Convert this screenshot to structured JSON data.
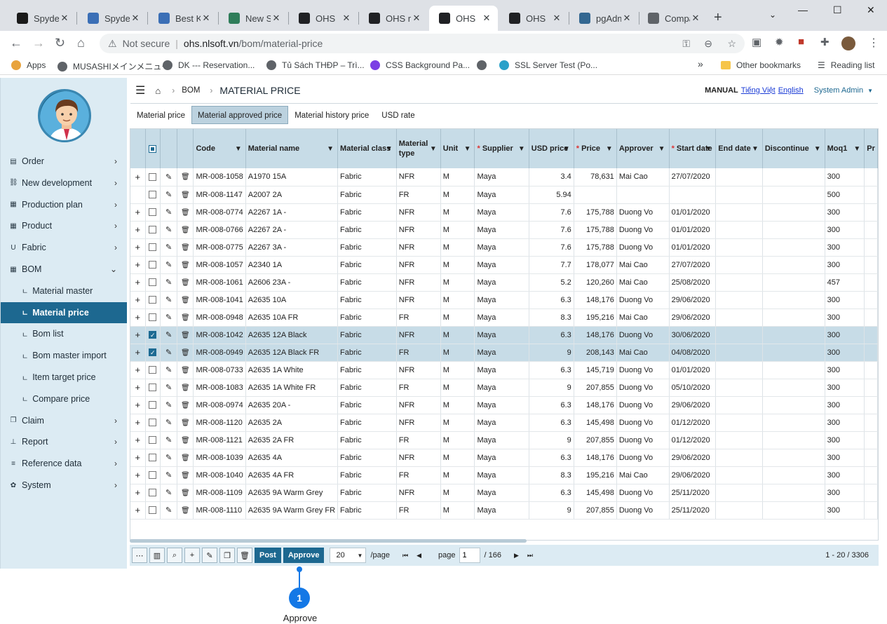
{
  "browser": {
    "tabs": [
      {
        "title": "Spyder",
        "color": "#1a1a1a"
      },
      {
        "title": "Spyder",
        "color": "#3b6fb6"
      },
      {
        "title": "Best K",
        "color": "#3b6fb6"
      },
      {
        "title": "New Sp",
        "color": "#2f7d5a"
      },
      {
        "title": "OHS",
        "color": "#202124"
      },
      {
        "title": "OHS m",
        "color": "#202124"
      },
      {
        "title": "OHS",
        "color": "#202124"
      },
      {
        "title": "OHS",
        "color": "#202124"
      },
      {
        "title": "pgAdm",
        "color": "#336791"
      },
      {
        "title": "Compa",
        "color": "#5f6368"
      }
    ],
    "active_tab": 6,
    "new_tab": "+",
    "url_security": "Not secure",
    "url_host": "ohs.nlsoft.vn",
    "url_path": "/bom/material-price",
    "bookmarks": [
      "Apps",
      "MUSASHIメインメニュー",
      "DK --- Reservation...",
      "Tủ Sách THĐP – Trì...",
      "CSS Background Pa...",
      "",
      "SSL Server Test (Po..."
    ],
    "other_bookmarks": "Other bookmarks",
    "reading_list": "Reading list",
    "more_bookmarks": "»"
  },
  "sidebar": {
    "items": [
      {
        "label": "Order",
        "icon": "document-icon",
        "type": "main"
      },
      {
        "label": "New development",
        "icon": "link-icon",
        "type": "main"
      },
      {
        "label": "Production plan",
        "icon": "grid-icon",
        "type": "main"
      },
      {
        "label": "Product",
        "icon": "grid-icon",
        "type": "main"
      },
      {
        "label": "Fabric",
        "icon": "magnet-icon",
        "type": "main"
      },
      {
        "label": "BOM",
        "icon": "grid-icon",
        "type": "open"
      },
      {
        "label": "Material master",
        "type": "sub"
      },
      {
        "label": "Material price",
        "type": "sub",
        "active": true
      },
      {
        "label": "Bom list",
        "type": "sub"
      },
      {
        "label": "Bom master import",
        "type": "sub"
      },
      {
        "label": "Item target price",
        "type": "sub"
      },
      {
        "label": "Compare price",
        "type": "sub"
      },
      {
        "label": "Claim",
        "icon": "copy-icon",
        "type": "main"
      },
      {
        "label": "Report",
        "icon": "sitemap-icon",
        "type": "main"
      },
      {
        "label": "Reference data",
        "icon": "database-icon",
        "type": "main"
      },
      {
        "label": "System",
        "icon": "gear-icon",
        "type": "main"
      }
    ]
  },
  "header": {
    "breadcrumb_bom": "BOM",
    "page_title": "MATERIAL PRICE",
    "manual": "MANUAL",
    "lang_vi": "Tiếng Việt",
    "lang_en": "English",
    "user": "System Admin"
  },
  "subtabs": [
    "Material price",
    "Material approved price",
    "Material history price",
    "USD rate"
  ],
  "active_subtab": 1,
  "grid": {
    "columns": [
      {
        "label": "Code",
        "filter": true
      },
      {
        "label": "Material name",
        "filter": true
      },
      {
        "label": "Material class",
        "filter": true
      },
      {
        "label": "Material type",
        "filter": true
      },
      {
        "label": "Unit",
        "filter": true
      },
      {
        "label": "Supplier",
        "filter": true,
        "required": true
      },
      {
        "label": "USD price",
        "filter": true
      },
      {
        "label": "Price",
        "filter": true,
        "required": true
      },
      {
        "label": "Approver",
        "filter": true
      },
      {
        "label": "Start date",
        "filter": true,
        "required": true
      },
      {
        "label": "End date",
        "filter": true
      },
      {
        "label": "Discontinue",
        "filter": true
      },
      {
        "label": "Moq1",
        "filter": true
      },
      {
        "label": "Pr",
        "filter": false
      }
    ],
    "rows": [
      {
        "code": "MR-008-1058",
        "name": "A1970 15A",
        "cls": "Fabric",
        "type": "NFR",
        "unit": "M",
        "supplier": "Maya",
        "usd": "3.4",
        "price": "78,631",
        "approver": "Mai Cao",
        "start": "27/07/2020",
        "end": "",
        "disc": "",
        "moq1": "300",
        "checked": false,
        "expand": true
      },
      {
        "code": "MR-008-1147",
        "name": "A2007 2A",
        "cls": "Fabric",
        "type": "FR",
        "unit": "M",
        "supplier": "Maya",
        "usd": "5.94",
        "price": "",
        "approver": "",
        "start": "",
        "end": "",
        "disc": "",
        "moq1": "500",
        "checked": false,
        "expand": false
      },
      {
        "code": "MR-008-0774",
        "name": "A2267 1A -",
        "cls": "Fabric",
        "type": "NFR",
        "unit": "M",
        "supplier": "Maya",
        "usd": "7.6",
        "price": "175,788",
        "approver": "Duong Vo",
        "start": "01/01/2020",
        "end": "",
        "disc": "",
        "moq1": "300",
        "checked": false,
        "expand": true
      },
      {
        "code": "MR-008-0766",
        "name": "A2267 2A -",
        "cls": "Fabric",
        "type": "NFR",
        "unit": "M",
        "supplier": "Maya",
        "usd": "7.6",
        "price": "175,788",
        "approver": "Duong Vo",
        "start": "01/01/2020",
        "end": "",
        "disc": "",
        "moq1": "300",
        "checked": false,
        "expand": true
      },
      {
        "code": "MR-008-0775",
        "name": "A2267 3A -",
        "cls": "Fabric",
        "type": "NFR",
        "unit": "M",
        "supplier": "Maya",
        "usd": "7.6",
        "price": "175,788",
        "approver": "Duong Vo",
        "start": "01/01/2020",
        "end": "",
        "disc": "",
        "moq1": "300",
        "checked": false,
        "expand": true
      },
      {
        "code": "MR-008-1057",
        "name": "A2340 1A",
        "cls": "Fabric",
        "type": "NFR",
        "unit": "M",
        "supplier": "Maya",
        "usd": "7.7",
        "price": "178,077",
        "approver": "Mai Cao",
        "start": "27/07/2020",
        "end": "",
        "disc": "",
        "moq1": "300",
        "checked": false,
        "expand": true
      },
      {
        "code": "MR-008-1061",
        "name": "A2606 23A -",
        "cls": "Fabric",
        "type": "NFR",
        "unit": "M",
        "supplier": "Maya",
        "usd": "5.2",
        "price": "120,260",
        "approver": "Mai Cao",
        "start": "25/08/2020",
        "end": "",
        "disc": "",
        "moq1": "457",
        "checked": false,
        "expand": true
      },
      {
        "code": "MR-008-1041",
        "name": "A2635 10A",
        "cls": "Fabric",
        "type": "NFR",
        "unit": "M",
        "supplier": "Maya",
        "usd": "6.3",
        "price": "148,176",
        "approver": "Duong Vo",
        "start": "29/06/2020",
        "end": "",
        "disc": "",
        "moq1": "300",
        "checked": false,
        "expand": true
      },
      {
        "code": "MR-008-0948",
        "name": "A2635 10A FR",
        "cls": "Fabric",
        "type": "FR",
        "unit": "M",
        "supplier": "Maya",
        "usd": "8.3",
        "price": "195,216",
        "approver": "Mai Cao",
        "start": "29/06/2020",
        "end": "",
        "disc": "",
        "moq1": "300",
        "checked": false,
        "expand": true
      },
      {
        "code": "MR-008-1042",
        "name": "A2635 12A Black",
        "cls": "Fabric",
        "type": "NFR",
        "unit": "M",
        "supplier": "Maya",
        "usd": "6.3",
        "price": "148,176",
        "approver": "Duong Vo",
        "start": "30/06/2020",
        "end": "",
        "disc": "",
        "moq1": "300",
        "checked": true,
        "expand": true
      },
      {
        "code": "MR-008-0949",
        "name": "A2635 12A Black FR",
        "cls": "Fabric",
        "type": "FR",
        "unit": "M",
        "supplier": "Maya",
        "usd": "9",
        "price": "208,143",
        "approver": "Mai Cao",
        "start": "04/08/2020",
        "end": "",
        "disc": "",
        "moq1": "300",
        "checked": true,
        "expand": true
      },
      {
        "code": "MR-008-0733",
        "name": "A2635 1A White",
        "cls": "Fabric",
        "type": "NFR",
        "unit": "M",
        "supplier": "Maya",
        "usd": "6.3",
        "price": "145,719",
        "approver": "Duong Vo",
        "start": "01/01/2020",
        "end": "",
        "disc": "",
        "moq1": "300",
        "checked": false,
        "expand": true
      },
      {
        "code": "MR-008-1083",
        "name": "A2635 1A White FR",
        "cls": "Fabric",
        "type": "FR",
        "unit": "M",
        "supplier": "Maya",
        "usd": "9",
        "price": "207,855",
        "approver": "Duong Vo",
        "start": "05/10/2020",
        "end": "",
        "disc": "",
        "moq1": "300",
        "checked": false,
        "expand": true
      },
      {
        "code": "MR-008-0974",
        "name": "A2635 20A -",
        "cls": "Fabric",
        "type": "NFR",
        "unit": "M",
        "supplier": "Maya",
        "usd": "6.3",
        "price": "148,176",
        "approver": "Duong Vo",
        "start": "29/06/2020",
        "end": "",
        "disc": "",
        "moq1": "300",
        "checked": false,
        "expand": true
      },
      {
        "code": "MR-008-1120",
        "name": "A2635 2A",
        "cls": "Fabric",
        "type": "NFR",
        "unit": "M",
        "supplier": "Maya",
        "usd": "6.3",
        "price": "145,498",
        "approver": "Duong Vo",
        "start": "01/12/2020",
        "end": "",
        "disc": "",
        "moq1": "300",
        "checked": false,
        "expand": true
      },
      {
        "code": "MR-008-1121",
        "name": "A2635 2A FR",
        "cls": "Fabric",
        "type": "FR",
        "unit": "M",
        "supplier": "Maya",
        "usd": "9",
        "price": "207,855",
        "approver": "Duong Vo",
        "start": "01/12/2020",
        "end": "",
        "disc": "",
        "moq1": "300",
        "checked": false,
        "expand": true
      },
      {
        "code": "MR-008-1039",
        "name": "A2635 4A",
        "cls": "Fabric",
        "type": "NFR",
        "unit": "M",
        "supplier": "Maya",
        "usd": "6.3",
        "price": "148,176",
        "approver": "Duong Vo",
        "start": "29/06/2020",
        "end": "",
        "disc": "",
        "moq1": "300",
        "checked": false,
        "expand": true
      },
      {
        "code": "MR-008-1040",
        "name": "A2635 4A FR",
        "cls": "Fabric",
        "type": "FR",
        "unit": "M",
        "supplier": "Maya",
        "usd": "8.3",
        "price": "195,216",
        "approver": "Mai Cao",
        "start": "29/06/2020",
        "end": "",
        "disc": "",
        "moq1": "300",
        "checked": false,
        "expand": true
      },
      {
        "code": "MR-008-1109",
        "name": "A2635 9A Warm Grey",
        "cls": "Fabric",
        "type": "NFR",
        "unit": "M",
        "supplier": "Maya",
        "usd": "6.3",
        "price": "145,498",
        "approver": "Duong Vo",
        "start": "25/11/2020",
        "end": "",
        "disc": "",
        "moq1": "300",
        "checked": false,
        "expand": true
      },
      {
        "code": "MR-008-1110",
        "name": "A2635 9A Warm Grey FR",
        "cls": "Fabric",
        "type": "FR",
        "unit": "M",
        "supplier": "Maya",
        "usd": "9",
        "price": "207,855",
        "approver": "Duong Vo",
        "start": "25/11/2020",
        "end": "",
        "disc": "",
        "moq1": "300",
        "checked": false,
        "expand": true
      }
    ]
  },
  "pager": {
    "post": "Post",
    "approve": "Approve",
    "page_size": "20",
    "per_page": "/page",
    "page_label": "page",
    "page": "1",
    "total_pages": "/ 166",
    "range": "1 - 20 / 3306"
  },
  "callout": {
    "number": "1",
    "label": "Approve",
    "color": "#1478e6"
  }
}
